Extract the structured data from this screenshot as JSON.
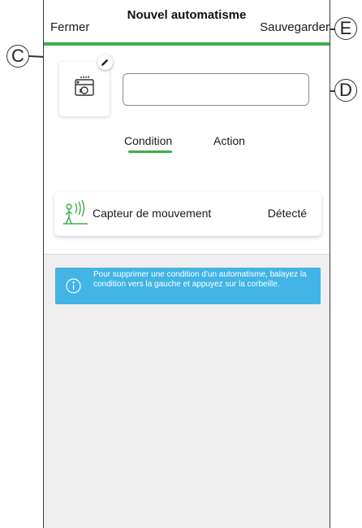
{
  "header": {
    "close_label": "Fermer",
    "title": "Nouvel automatisme",
    "save_label": "Sauvegarder"
  },
  "automation": {
    "name_value": "",
    "icon": "dishwasher-icon",
    "edit_icon": "pencil-icon"
  },
  "tabs": [
    {
      "label": "Condition",
      "active": true
    },
    {
      "label": "Action",
      "active": false
    }
  ],
  "conditions": [
    {
      "icon": "motion-sensor-icon",
      "name": "Capteur de mouvement",
      "state": "Détecté"
    }
  ],
  "info": {
    "icon": "info-icon",
    "text": "Pour supprimer une condition d'un automatisme, balayez la condition vers la gauche et appuyez sur la corbeille."
  },
  "callouts": {
    "c": "C",
    "d": "D",
    "e": "E"
  },
  "colors": {
    "accent": "#3dae49",
    "info": "#42b4e6",
    "background_gray": "#efefef"
  }
}
